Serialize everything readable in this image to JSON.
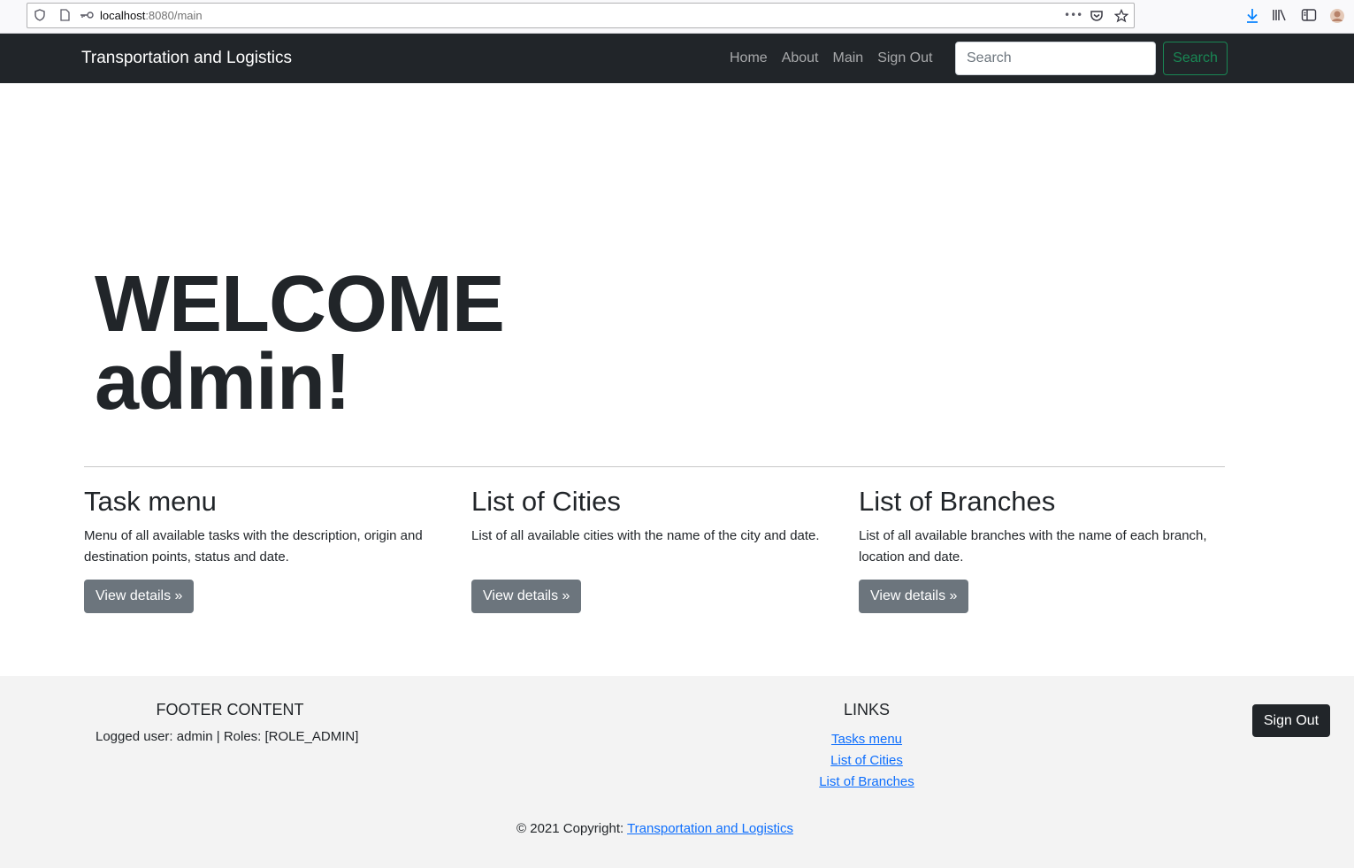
{
  "browser": {
    "url_host": "localhost",
    "url_rest": ":8080/main"
  },
  "navbar": {
    "brand": "Transportation and Logistics",
    "links": [
      "Home",
      "About",
      "Main",
      "Sign Out"
    ],
    "search_placeholder": "Search",
    "search_button": "Search"
  },
  "hero": {
    "line1": "WELCOME",
    "line2": "admin!"
  },
  "cards": [
    {
      "title": "Task menu",
      "text": "Menu of all available tasks with the description, origin and destination points, status and date.",
      "button": "View details »"
    },
    {
      "title": "List of Cities",
      "text": "List of all available cities with the name of the city and date.",
      "button": "View details »"
    },
    {
      "title": "List of Branches",
      "text": "List of all available branches with the name of each branch, location and date.",
      "button": "View details »"
    }
  ],
  "footer": {
    "content_title": "FOOTER CONTENT",
    "user_info": "Logged user: admin | Roles: [ROLE_ADMIN]",
    "links_title": "LINKS",
    "links": [
      "Tasks menu",
      "List of Cities",
      "List of Branches"
    ],
    "signout_button": "Sign Out",
    "copyright_prefix": "© 2021 Copyright: ",
    "copyright_link": "Transportation and Logistics"
  },
  "colors": {
    "navbar_bg": "#212529",
    "success": "#198754",
    "secondary": "#6c757d",
    "link": "#0d6efd",
    "footer_bg": "#f3f3f3"
  }
}
